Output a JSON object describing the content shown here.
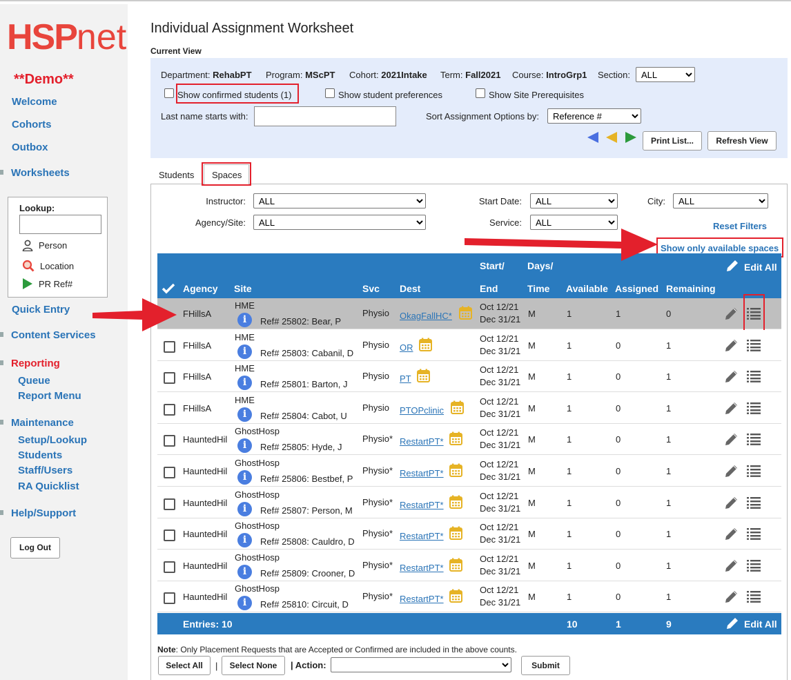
{
  "brand": {
    "logo_main": "HSP",
    "logo_suffix": "net",
    "demo_label": "**Demo**"
  },
  "sidebar": {
    "welcome": "Welcome",
    "cohorts": "Cohorts",
    "outbox": "Outbox",
    "worksheets": "Worksheets",
    "lookup": {
      "title": "Lookup:",
      "person": "Person",
      "location": "Location",
      "pr_ref": "PR Ref#"
    },
    "quick_entry": "Quick Entry",
    "content_services": "Content Services",
    "reporting": "Reporting",
    "queue": "Queue",
    "report_menu": "Report Menu",
    "maintenance": "Maintenance",
    "setup_lookup": "Setup/Lookup",
    "students": "Students",
    "staff_users": "Staff/Users",
    "ra_quicklist": "RA Quicklist",
    "help_support": "Help/Support",
    "logout": "Log Out"
  },
  "page": {
    "title": "Individual Assignment Worksheet",
    "current_view": "Current View"
  },
  "view": {
    "department_label": "Department:",
    "department": "RehabPT",
    "program_label": "Program:",
    "program": "MScPT",
    "cohort_label": "Cohort:",
    "cohort": "2021Intake",
    "term_label": "Term:",
    "term": "Fall2021",
    "course_label": "Course:",
    "course": "IntroGrp1",
    "section_label": "Section:",
    "section": "ALL",
    "show_confirmed": "Show confirmed students (1)",
    "show_preferences": "Show student preferences",
    "show_prereqs": "Show Site Prerequisites",
    "last_name_label": "Last name starts with:",
    "sort_label": "Sort Assignment Options by:",
    "sort_value": "Reference #",
    "print_list": "Print List...",
    "refresh_view": "Refresh View"
  },
  "tabs": {
    "students": "Students",
    "spaces": "Spaces"
  },
  "filters": {
    "instructor_label": "Instructor:",
    "instructor": "ALL",
    "agency_label": "Agency/Site:",
    "agency": "ALL",
    "start_date_label": "Start Date:",
    "start_date": "ALL",
    "service_label": "Service:",
    "service": "ALL",
    "city_label": "City:",
    "city": "ALL",
    "reset_filters": "Reset Filters",
    "show_available": "Show only available spaces"
  },
  "table": {
    "headers": {
      "agency": "Agency",
      "site": "Site",
      "svc": "Svc",
      "dest": "Dest",
      "start": "Start/",
      "end": "End",
      "days": "Days/",
      "time": "Time",
      "available": "Available",
      "assigned": "Assigned",
      "remaining": "Remaining",
      "edit_all": "Edit All"
    },
    "rows": [
      {
        "agency": "FHillsA",
        "site": "HME",
        "ref": "Ref# 25802: Bear, P",
        "svc": "Physio",
        "dest": "OkagFallHC*",
        "start": "Oct 12/21",
        "end": "Dec 31/21",
        "days": "M",
        "available": "1",
        "assigned": "1",
        "remaining": "0"
      },
      {
        "agency": "FHillsA",
        "site": "HME",
        "ref": "Ref# 25803: Cabanil, D",
        "svc": "Physio",
        "dest": "OR",
        "start": "Oct 12/21",
        "end": "Dec 31/21",
        "days": "M",
        "available": "1",
        "assigned": "0",
        "remaining": "1"
      },
      {
        "agency": "FHillsA",
        "site": "HME",
        "ref": "Ref# 25801: Barton, J",
        "svc": "Physio",
        "dest": "PT",
        "start": "Oct 12/21",
        "end": "Dec 31/21",
        "days": "M",
        "available": "1",
        "assigned": "0",
        "remaining": "1"
      },
      {
        "agency": "FHillsA",
        "site": "HME",
        "ref": "Ref# 25804: Cabot, U",
        "svc": "Physio",
        "dest": "PTOPclinic",
        "start": "Oct 12/21",
        "end": "Dec 31/21",
        "days": "M",
        "available": "1",
        "assigned": "0",
        "remaining": "1"
      },
      {
        "agency": "HauntedHil",
        "site": "GhostHosp",
        "ref": "Ref# 25805: Hyde, J",
        "svc": "Physio*",
        "dest": "RestartPT*",
        "start": "Oct 12/21",
        "end": "Dec 31/21",
        "days": "M",
        "available": "1",
        "assigned": "0",
        "remaining": "1"
      },
      {
        "agency": "HauntedHil",
        "site": "GhostHosp",
        "ref": "Ref# 25806: Bestbef, P",
        "svc": "Physio*",
        "dest": "RestartPT*",
        "start": "Oct 12/21",
        "end": "Dec 31/21",
        "days": "M",
        "available": "1",
        "assigned": "0",
        "remaining": "1"
      },
      {
        "agency": "HauntedHil",
        "site": "GhostHosp",
        "ref": "Ref# 25807: Person, M",
        "svc": "Physio*",
        "dest": "RestartPT*",
        "start": "Oct 12/21",
        "end": "Dec 31/21",
        "days": "M",
        "available": "1",
        "assigned": "0",
        "remaining": "1"
      },
      {
        "agency": "HauntedHil",
        "site": "GhostHosp",
        "ref": "Ref# 25808: Cauldro, D",
        "svc": "Physio*",
        "dest": "RestartPT*",
        "start": "Oct 12/21",
        "end": "Dec 31/21",
        "days": "M",
        "available": "1",
        "assigned": "0",
        "remaining": "1"
      },
      {
        "agency": "HauntedHil",
        "site": "GhostHosp",
        "ref": "Ref# 25809: Crooner, D",
        "svc": "Physio*",
        "dest": "RestartPT*",
        "start": "Oct 12/21",
        "end": "Dec 31/21",
        "days": "M",
        "available": "1",
        "assigned": "0",
        "remaining": "1"
      },
      {
        "agency": "HauntedHil",
        "site": "GhostHosp",
        "ref": "Ref# 25810: Circuit, D",
        "svc": "Physio*",
        "dest": "RestartPT*",
        "start": "Oct 12/21",
        "end": "Dec 31/21",
        "days": "M",
        "available": "1",
        "assigned": "0",
        "remaining": "1"
      }
    ],
    "footer": {
      "entries": "Entries: 10",
      "available": "10",
      "assigned": "1",
      "remaining": "9",
      "edit_all": "Edit All"
    }
  },
  "note": {
    "label": "Note",
    "text": ": Only Placement Requests that are Accepted or Confirmed are included in the above counts."
  },
  "actions": {
    "select_all": "Select All",
    "separator": "|",
    "select_none": "Select None",
    "action_label": "| Action:",
    "submit": "Submit"
  },
  "colors": {
    "header_blue": "#2a7bbf",
    "link_blue": "#2a74b7",
    "brand_red": "#e8453c",
    "annotation_red": "#e3202c",
    "calendar_gold": "#e6b325",
    "view_bg": "#e4ecfb"
  }
}
